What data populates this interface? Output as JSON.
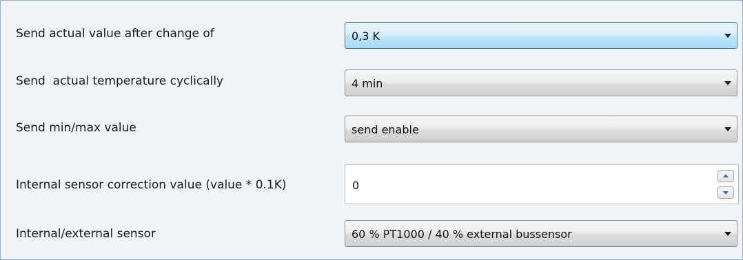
{
  "parameters": [
    {
      "label": "Send actual value after change of",
      "value": "0,3 K"
    },
    {
      "label": "Send  actual temperature cyclically",
      "value": "4 min"
    },
    {
      "label": "Send min/max value",
      "value": "send enable"
    },
    {
      "label": "Internal sensor correction value (value * 0.1K)",
      "value": "0"
    },
    {
      "label": "Internal/external sensor",
      "value": "60 % PT1000 / 40 % external bussensor"
    }
  ],
  "colors": {
    "panel_background": "#f0f4f9",
    "panel_border": "#8fb0d4",
    "focused_combo_border": "#3c7fb1"
  },
  "icons": {
    "dropdown": "chevron-down-icon",
    "spin_up": "spin-up-icon",
    "spin_down": "spin-down-icon"
  }
}
